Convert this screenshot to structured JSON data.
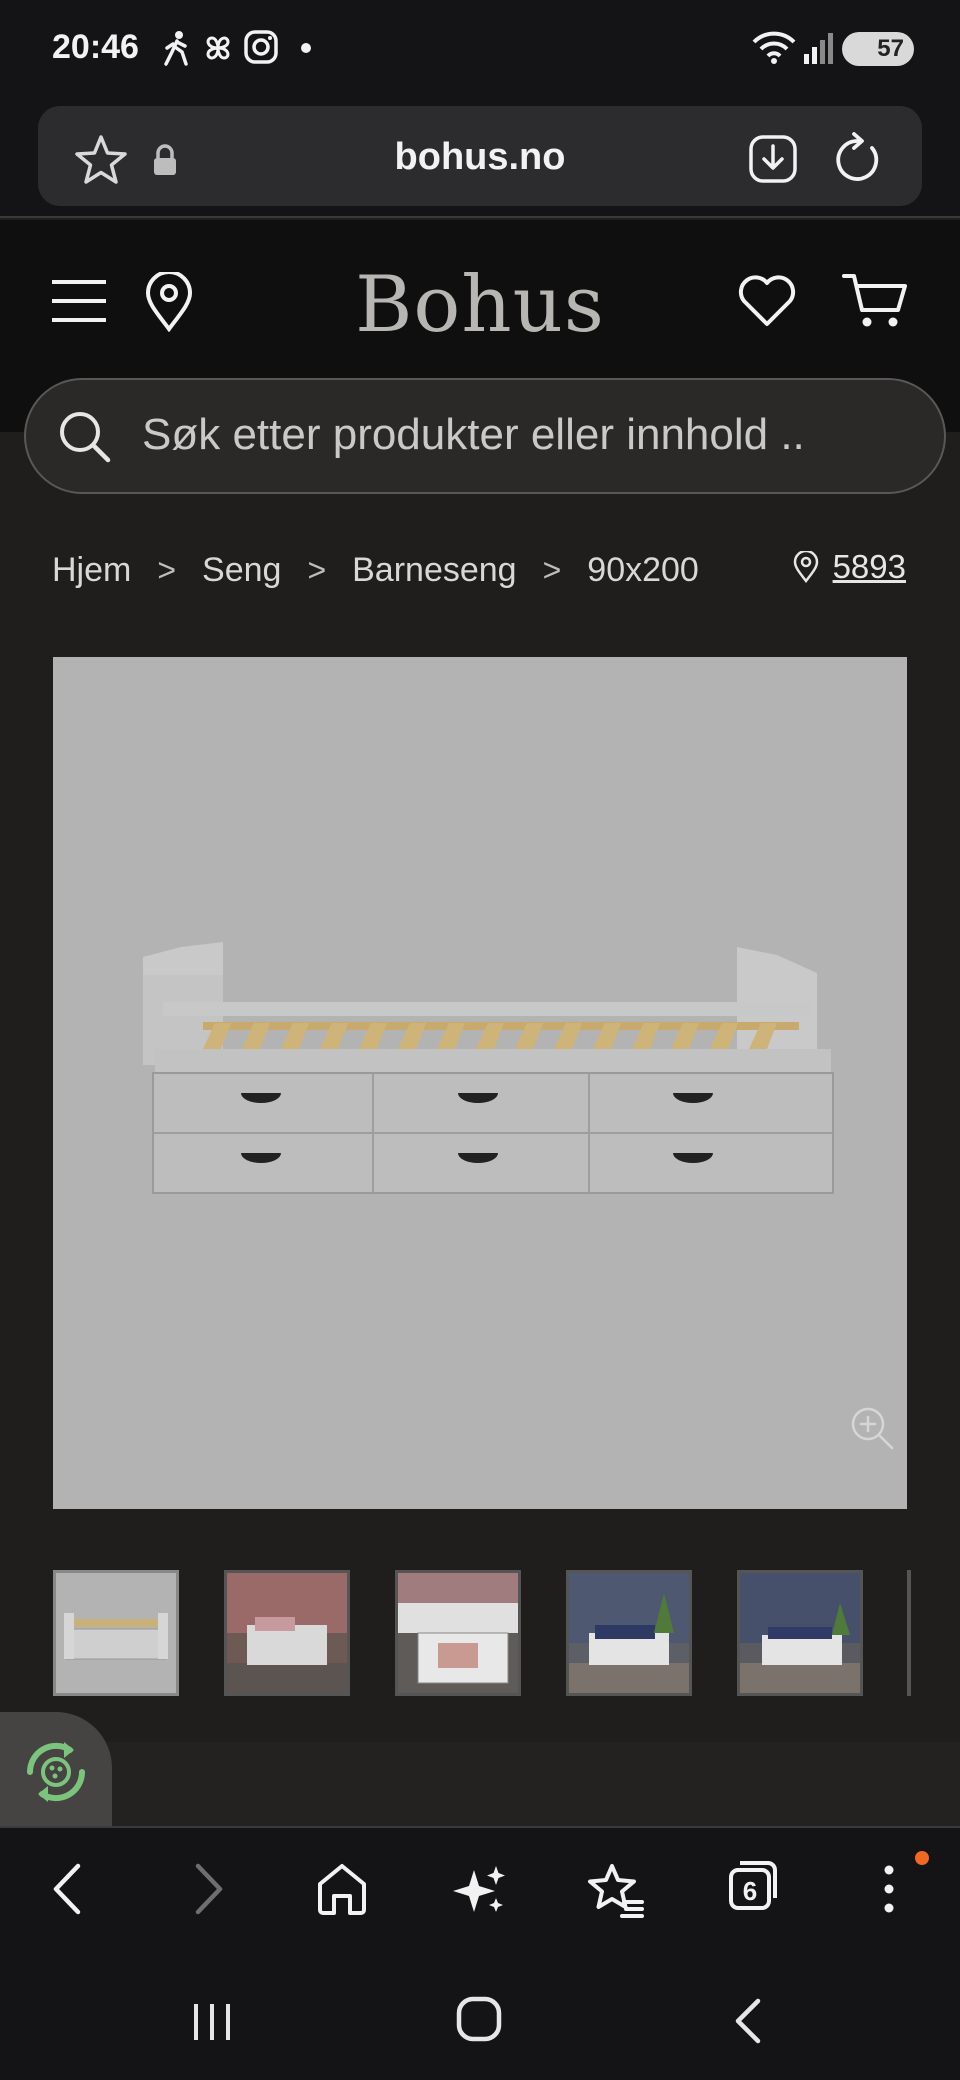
{
  "status_bar": {
    "time": "20:46",
    "battery": "57"
  },
  "browser": {
    "url": "bohus.no",
    "tab_count": "6"
  },
  "site": {
    "logo": "Bohus",
    "search_placeholder": "Søk etter produkter eller innhold .."
  },
  "breadcrumb": {
    "items": [
      "Hjem",
      "Seng",
      "Barneseng",
      "90x200"
    ],
    "separator": ">"
  },
  "store": {
    "number": "5893"
  },
  "thumbnails": [
    "bed-product-white",
    "bed-pink-room",
    "bed-drawers-open",
    "bed-blue-wallpaper",
    "bed-floral-wallpaper"
  ],
  "panel": {
    "partial_text": ""
  },
  "colors": {
    "page_bg": "#1f1e1d",
    "header_bg": "#0f0f10",
    "image_bg": "#b3b3b3",
    "accent_dot": "#f26722",
    "eco_green": "#7cc47e"
  }
}
